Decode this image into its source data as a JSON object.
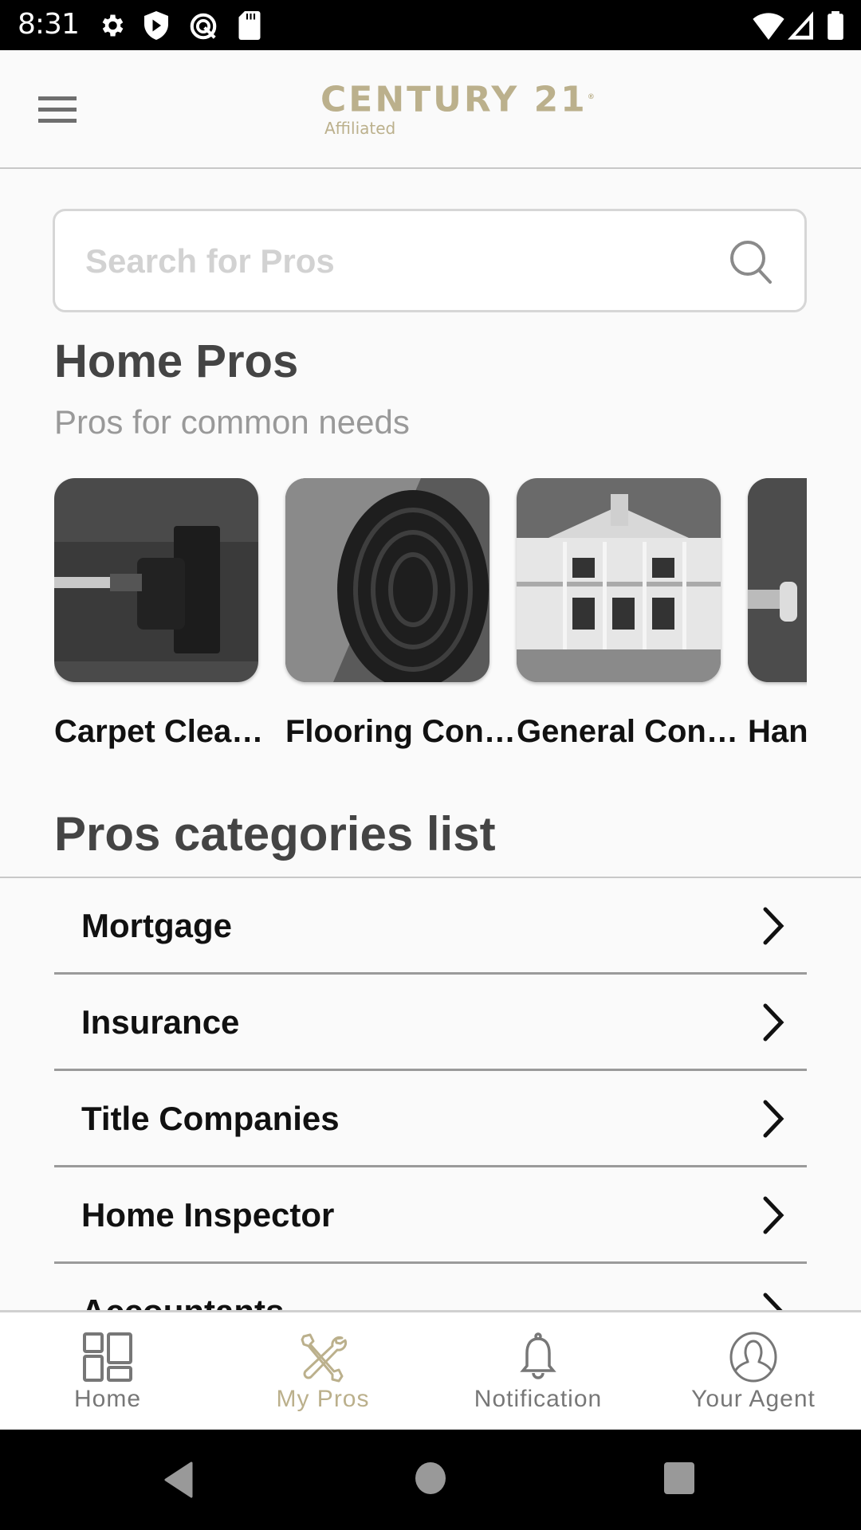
{
  "status_bar": {
    "time": "8:31",
    "left_icons": [
      "settings-icon",
      "shield-play-icon",
      "android-q-icon",
      "sd-card-icon"
    ],
    "right_icons": [
      "wifi-icon",
      "cell-signal-icon",
      "battery-icon"
    ]
  },
  "app_bar": {
    "menu_icon": "hamburger-menu-icon",
    "logo_brand": "CENTURY 21",
    "logo_mark": "®",
    "logo_sub": "Affiliated"
  },
  "search": {
    "placeholder": "Search for Pros",
    "value": "",
    "icon": "search-icon"
  },
  "home_pros": {
    "title": "Home Pros",
    "subtitle": "Pros for common needs",
    "cards": [
      {
        "label": "Carpet Clea…",
        "image": "vacuum-on-carpet-photo"
      },
      {
        "label": "Flooring Con…",
        "image": "rolled-rug-photo"
      },
      {
        "label": "General Con…",
        "image": "two-story-house-photo"
      },
      {
        "label": "Han",
        "image": "handyman-tool-photo"
      }
    ]
  },
  "categories": {
    "title": "Pros categories list",
    "items": [
      {
        "label": "Mortgage"
      },
      {
        "label": "Insurance"
      },
      {
        "label": "Title Companies"
      },
      {
        "label": "Home Inspector"
      },
      {
        "label": "Accountants"
      }
    ]
  },
  "bottom_nav": {
    "active_index": 1,
    "tabs": [
      {
        "label": "Home",
        "icon": "dashboard-grid-icon"
      },
      {
        "label": "My Pros",
        "icon": "tools-wrench-screwdriver-icon"
      },
      {
        "label": "Notification",
        "icon": "bell-icon"
      },
      {
        "label": "Your Agent",
        "icon": "person-avatar-icon"
      }
    ]
  },
  "system_nav": {
    "buttons": [
      "back",
      "home",
      "recents"
    ]
  },
  "colors": {
    "accent_gold": "#bbb08c",
    "text_dark": "#111111",
    "heading_gray": "#444444",
    "inactive_gray": "#777777",
    "background": "#fafafa"
  }
}
